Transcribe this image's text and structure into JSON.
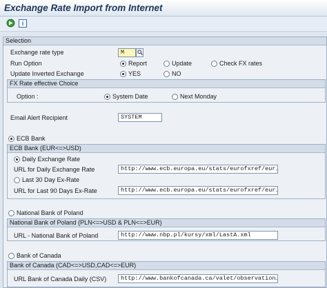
{
  "window": {
    "title": "Exchange Rate Import from Internet"
  },
  "toolbar": {
    "execute_icon": "execute-icon",
    "info_icon": "info-icon",
    "info_label": "i"
  },
  "selection": {
    "heading": "Selection",
    "exchange_rate_type": {
      "label": "Exchange rate type",
      "value": "M"
    },
    "run_option": {
      "label": "Run Option",
      "options": [
        "Report",
        "Update",
        "Check FX rates"
      ],
      "selected": "Report"
    },
    "update_inverted": {
      "label": "Update Inverted Exchange",
      "options": [
        "YES",
        "NO"
      ],
      "selected": "YES"
    },
    "fx_effective": {
      "heading": "FX Rate effective Choice",
      "option_label": "Option :",
      "options": [
        "System Date",
        "Next Monday"
      ],
      "selected": "System Date"
    },
    "email": {
      "label": "Email Alert Recipient",
      "value": "SYSTEM"
    }
  },
  "ecb": {
    "radio_label": "ECB Bank",
    "box_heading": "ECB Bank (EUR<=>USD)",
    "daily_radio": "Daily Exchange Rate",
    "daily_url_label": "URL for Daily Exchange Rate",
    "daily_url_value": "http://www.ecb.europa.eu/stats/eurofxref/eur…",
    "last30_radio": "Last 30 Day Ex-Rate",
    "last90_url_label": "URL for Last 90 Days Ex-Rate",
    "last90_url_value": "http://www.ecb.europa.eu/stats/eurofxref/eur…"
  },
  "poland": {
    "radio_label": "National Bank of Poland",
    "box_heading": "National Bank of Poland (PLN<=>USD & PLN<=>EUR)",
    "url_label": "URL - National Bank of Poland",
    "url_value": "http://www.nbp.pl/kursy/xml/LastA.xml"
  },
  "canada": {
    "radio_label": "Bank of Canada",
    "box_heading": "Bank of Canada (CAD<=>USD,CAD<=>EUR)",
    "url_label": "URL Bank of Canada Daily (CSV)",
    "url_value": "http://www.bankofcanada.ca/valet/observation…"
  },
  "colors": {
    "title": "#213758",
    "panel": "#edf1f6",
    "header": "#d3dce8",
    "required": "#fff6b8"
  }
}
